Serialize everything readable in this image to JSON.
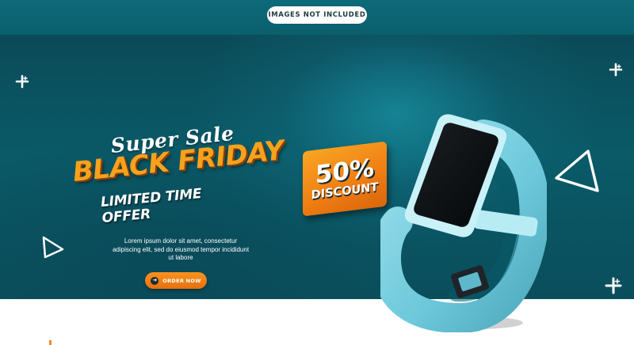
{
  "notice": {
    "text": "IMAGES NOT INCLUDED"
  },
  "hero": {
    "script_line": "Super Sale",
    "headline": "BLACK FRIDAY",
    "subheadline": "LIMITED TIME OFFER",
    "body": "Lorem ipsum dolor sit amet, consectetur adipiscing elit, sed do eiusmod tempor incididunt ut labore",
    "cta_label": "ORDER NOW",
    "cta_icon": "arrow-right-icon"
  },
  "badge": {
    "percent": "50%",
    "label": "DISCOUNT"
  },
  "colors": {
    "accent": "#f28a1a",
    "banner_teal": "#0a5a68",
    "band_blue": "#7fd3e3",
    "screen_black": "#0b0e10"
  },
  "decor": {
    "icons": [
      "sparkle-icon",
      "triangle-outline-icon",
      "smartwatch-icon"
    ]
  }
}
